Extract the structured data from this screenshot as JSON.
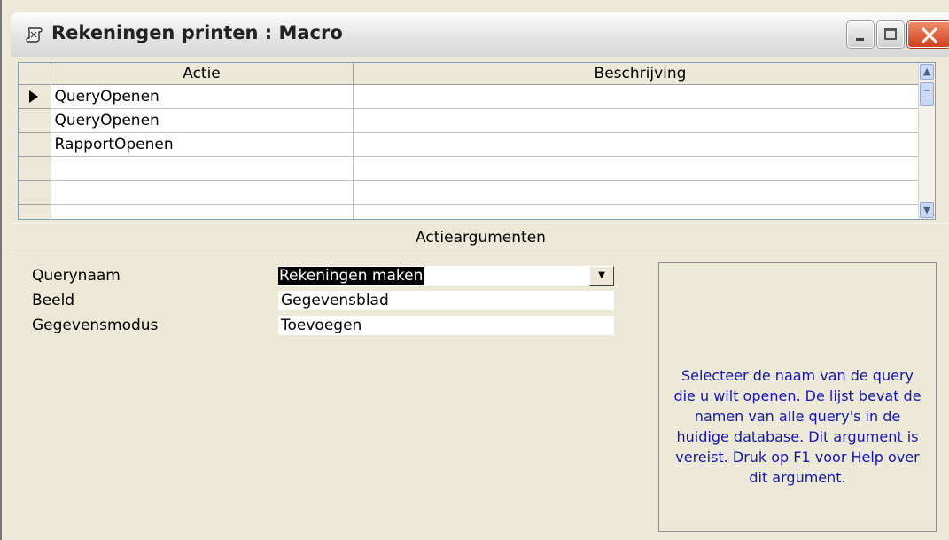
{
  "window": {
    "title": "Rekeningen printen : Macro"
  },
  "grid": {
    "columns": [
      "Actie",
      "Beschrijving"
    ],
    "rows": [
      {
        "actie": "QueryOpenen",
        "beschrijving": ""
      },
      {
        "actie": "QueryOpenen",
        "beschrijving": ""
      },
      {
        "actie": "RapportOpenen",
        "beschrijving": ""
      },
      {
        "actie": "",
        "beschrijving": ""
      },
      {
        "actie": "",
        "beschrijving": ""
      },
      {
        "actie": "",
        "beschrijving": ""
      }
    ]
  },
  "arguments": {
    "header": "Actieargumenten",
    "fields": [
      {
        "label": "Querynaam",
        "value": "Rekeningen maken"
      },
      {
        "label": "Beeld",
        "value": "Gegevensblad"
      },
      {
        "label": "Gegevensmodus",
        "value": "Toevoegen"
      }
    ],
    "help_text": "Selecteer de naam van de query die u wilt openen. De lijst bevat de namen van alle query's in de huidige database. Dit argument is vereist. Druk op F1 voor Help over dit argument."
  },
  "colors": {
    "help_text": "#1616a8",
    "window_bg": "#ece9d8",
    "close_button": "#d0401e"
  },
  "icons": {
    "app": "macro-scroll-icon",
    "current_row": "current-row-arrow-icon"
  }
}
